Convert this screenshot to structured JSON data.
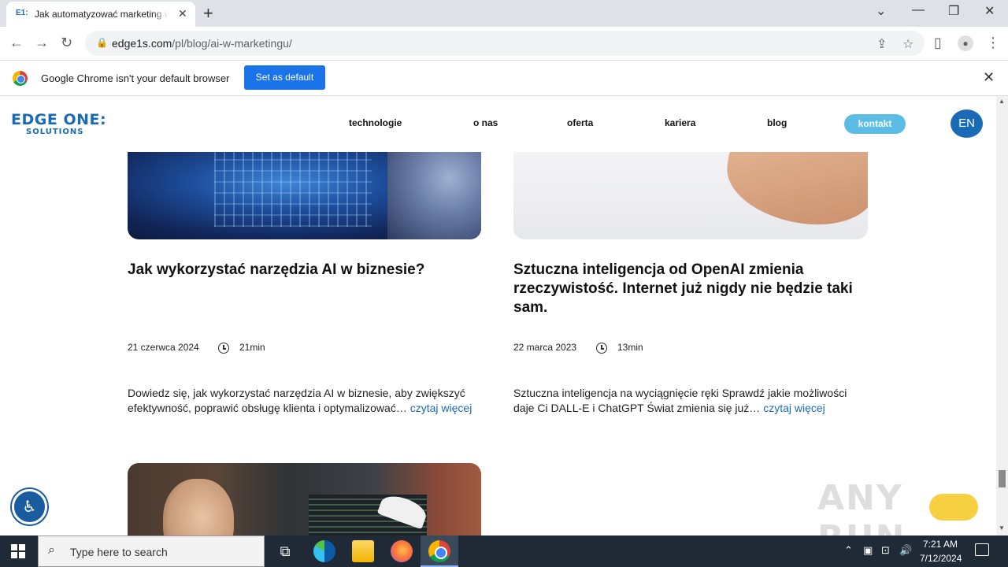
{
  "browser": {
    "tab_title": "Jak automatyzować marketing w",
    "tab_favicon_text": "E1:",
    "url_host": "edge1s.com",
    "url_path": "/pl/blog/ai-w-marketingu/",
    "infobar_message": "Google Chrome isn't your default browser",
    "infobar_button": "Set as default"
  },
  "site": {
    "logo_line1": "EDGE ONE:",
    "logo_line2": "SOLUTIONS",
    "nav": [
      "technologie",
      "o nas",
      "oferta",
      "kariera",
      "blog"
    ],
    "contact_button": "kontakt",
    "lang_button": "EN"
  },
  "posts": [
    {
      "title": "Jak wykorzystać narzędzia AI w biznesie?",
      "date": "21 czerwca 2024",
      "read_time": "21min",
      "excerpt": "Dowiedz się, jak wykorzystać narzędzia AI w biznesie, aby zwiększyć efektywność, poprawić obsługę klienta i optymalizować…",
      "read_more": "czytaj więcej"
    },
    {
      "title": "Sztuczna inteligencja od OpenAI zmienia rzeczywistość. Internet już nigdy nie będzie taki sam.",
      "date": "22 marca 2023",
      "read_time": "13min",
      "excerpt": "Sztuczna inteligencja na wyciągnięcie ręki Sprawdź jakie możliwości daje Ci DALL-E i ChatGPT Świat zmienia się już…",
      "read_more": "czytaj więcej"
    }
  ],
  "watermark": "ANY RUN",
  "taskbar": {
    "search_placeholder": "Type here to search",
    "time": "7:21 AM",
    "date": "7/12/2024"
  },
  "colors": {
    "brand_blue": "#1a6bb5",
    "contact_pill": "#5bbde5",
    "chrome_blue": "#1a73e8"
  }
}
